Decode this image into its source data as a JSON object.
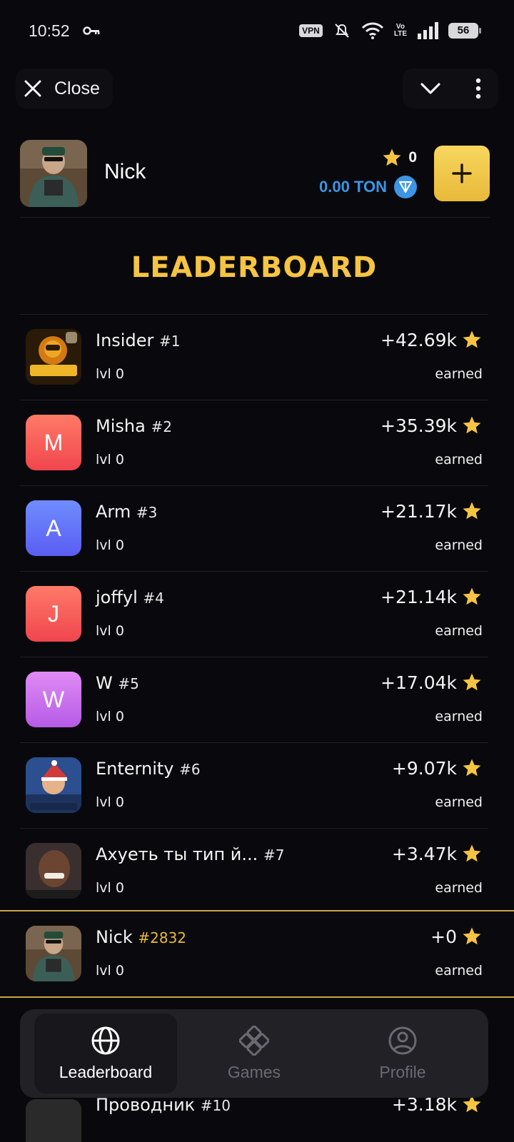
{
  "status_bar": {
    "time": "10:52",
    "vpn": "VPN",
    "volte_top": "Vo",
    "volte_bottom": "LTE",
    "battery": "56"
  },
  "top_bar": {
    "close_label": "Close"
  },
  "user": {
    "name": "Nick",
    "stars": "0",
    "ton_balance": "0.00 TON"
  },
  "title": "LEADERBOARD",
  "leaderboard": [
    {
      "name": "Insider",
      "rank": "#1",
      "level": "lvl 0",
      "score": "+42.69k",
      "earned": "earned",
      "avatar": "image"
    },
    {
      "name": "Misha",
      "rank": "#2",
      "level": "lvl 0",
      "score": "+35.39k",
      "earned": "earned",
      "avatar_letter": "M"
    },
    {
      "name": "Arm",
      "rank": "#3",
      "level": "lvl 0",
      "score": "+21.17k",
      "earned": "earned",
      "avatar_letter": "A"
    },
    {
      "name": "joffyl",
      "rank": "#4",
      "level": "lvl 0",
      "score": "+21.14k",
      "earned": "earned",
      "avatar_letter": "J"
    },
    {
      "name": "W",
      "rank": "#5",
      "level": "lvl 0",
      "score": "+17.04k",
      "earned": "earned",
      "avatar_letter": "W"
    },
    {
      "name": "Enternity",
      "rank": "#6",
      "level": "lvl 0",
      "score": "+9.07k",
      "earned": "earned",
      "avatar": "image"
    },
    {
      "name": "Ахуеть ты тип й...",
      "rank": "#7",
      "level": "lvl 0",
      "score": "+3.47k",
      "earned": "earned",
      "avatar": "image"
    }
  ],
  "my_entry": {
    "name": "Nick",
    "rank": "#2832",
    "level": "lvl 0",
    "score": "+0",
    "earned": "earned"
  },
  "peek_entry": {
    "name": "Проводник",
    "rank": "#10",
    "score": "+3.18k"
  },
  "nav": {
    "leaderboard": "Leaderboard",
    "games": "Games",
    "profile": "Profile"
  },
  "colors": {
    "accent_gold": "#f6c443",
    "ton_blue": "#3c95e6",
    "background": "#09090d"
  },
  "icons": [
    "key-icon",
    "mute-icon",
    "wifi-icon",
    "signal-icon",
    "close-icon",
    "chevron-down-icon",
    "more-vertical-icon",
    "star-icon",
    "ton-icon",
    "plus-icon",
    "globe-icon",
    "gamepad-icon",
    "profile-icon"
  ]
}
